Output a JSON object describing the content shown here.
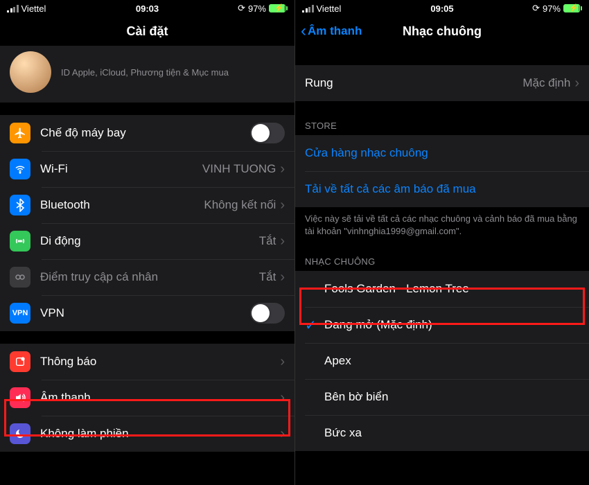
{
  "left": {
    "statusbar": {
      "carrier": "Viettel",
      "time": "09:03",
      "battery": "97%"
    },
    "title": "Cài đặt",
    "profile_sub": "ID Apple, iCloud, Phương tiện & Mục mua",
    "rows": {
      "airplane": {
        "label": "Chế độ máy bay"
      },
      "wifi": {
        "label": "Wi-Fi",
        "value": "VINH TUONG"
      },
      "bluetooth": {
        "label": "Bluetooth",
        "value": "Không kết nối"
      },
      "cellular": {
        "label": "Di động",
        "value": "Tắt"
      },
      "hotspot": {
        "label": "Điểm truy cập cá nhân",
        "value": "Tắt"
      },
      "vpn": {
        "label": "VPN"
      },
      "notifications": {
        "label": "Thông báo"
      },
      "sounds": {
        "label": "Âm thanh"
      },
      "dnd": {
        "label": "Không làm phiền"
      }
    }
  },
  "right": {
    "statusbar": {
      "carrier": "Viettel",
      "time": "09:05",
      "battery": "97%"
    },
    "back": "Âm thanh",
    "title": "Nhạc chuông",
    "vibration": {
      "label": "Rung",
      "value": "Mặc định"
    },
    "store_header": "STORE",
    "store": {
      "shop": "Cửa hàng nhạc chuông",
      "download": "Tải về tất cả các âm báo đã mua"
    },
    "store_footer": "Việc này sẽ tải về tất cả các nhạc chuông và cảnh báo đã mua bằng tài khoản \"vinhnghia1999@gmail.com\".",
    "ringtone_header": "NHẠC CHUÔNG",
    "ringtones": {
      "custom": "Fools Garden - Lemon Tree",
      "default": "Đang mở (Mặc định)",
      "r2": "Apex",
      "r3": "Bên bờ biển",
      "r4": "Bức xa"
    }
  }
}
